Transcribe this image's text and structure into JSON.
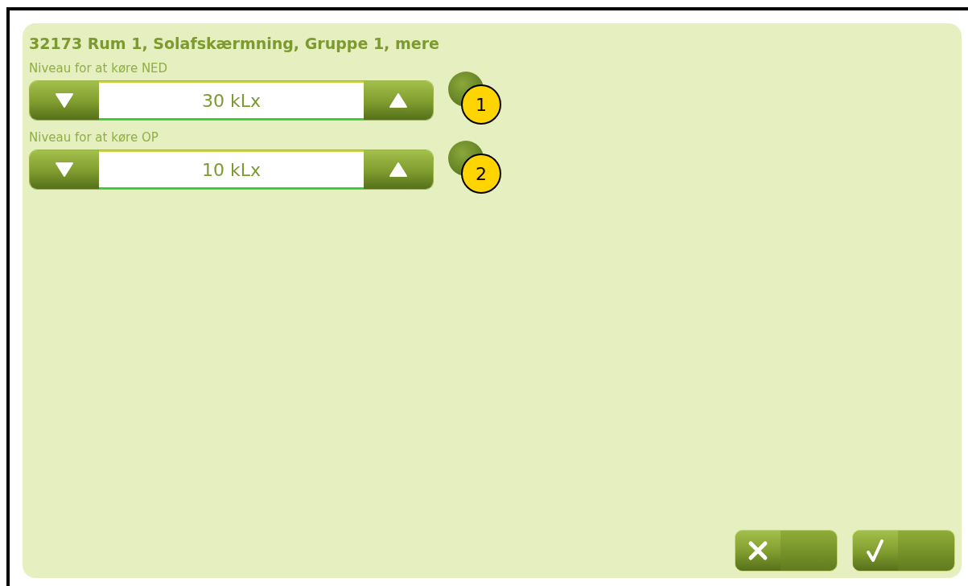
{
  "title": "32173 Rum 1, Solafskærmning, Gruppe 1, mere",
  "fields": [
    {
      "label": "Niveau for at køre NED",
      "value": "30 kLx",
      "badge": "1"
    },
    {
      "label": "Niveau for at køre OP",
      "value": "10 kLx",
      "badge": "2"
    }
  ],
  "buttons": [
    {
      "kind": "cancel"
    },
    {
      "kind": "confirm"
    }
  ]
}
